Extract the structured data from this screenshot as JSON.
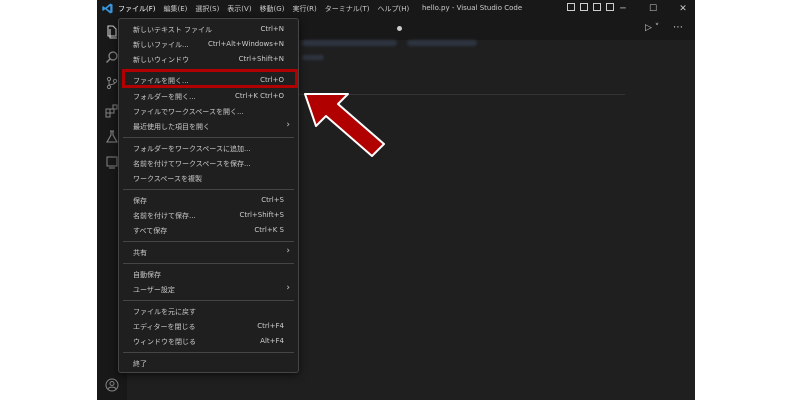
{
  "window_title": "hello.py - Visual Studio Code",
  "menubar": [
    "ファイル(F)",
    "編集(E)",
    "選択(S)",
    "表示(V)",
    "移動(G)",
    "実行(R)",
    "ターミナル(T)",
    "ヘルプ(H)"
  ],
  "window_controls": {
    "minimize": "─",
    "maximize": "☐",
    "close": "✕"
  },
  "activity_icons": [
    "explorer-icon",
    "search-icon",
    "source-control-icon",
    "extensions-icon",
    "testing-icon",
    "remote-icon",
    "account-icon"
  ],
  "file_menu": {
    "items": [
      {
        "label": "新しいテキスト ファイル",
        "shortcut": "Ctrl+N"
      },
      {
        "label": "新しいファイル...",
        "shortcut": "Ctrl+Alt+Windows+N"
      },
      {
        "label": "新しいウィンドウ",
        "shortcut": "Ctrl+Shift+N"
      },
      {
        "label": "ファイルを開く...",
        "shortcut": "Ctrl+O"
      },
      {
        "label": "フォルダーを開く...",
        "shortcut": "Ctrl+K Ctrl+O"
      },
      {
        "label": "ファイルでワークスペースを開く...",
        "shortcut": ""
      },
      {
        "label": "最近使用した項目を開く",
        "shortcut": "",
        "submenu": true
      },
      {
        "label": "フォルダーをワークスペースに追加...",
        "shortcut": ""
      },
      {
        "label": "名前を付けてワークスペースを保存...",
        "shortcut": ""
      },
      {
        "label": "ワークスペースを複製",
        "shortcut": ""
      },
      {
        "label": "保存",
        "shortcut": "Ctrl+S"
      },
      {
        "label": "名前を付けて保存...",
        "shortcut": "Ctrl+Shift+S"
      },
      {
        "label": "すべて保存",
        "shortcut": "Ctrl+K S"
      },
      {
        "label": "共有",
        "shortcut": "",
        "submenu": true
      },
      {
        "label": "自動保存",
        "shortcut": ""
      },
      {
        "label": "ユーザー設定",
        "shortcut": "",
        "submenu": true
      },
      {
        "label": "ファイルを元に戻す",
        "shortcut": ""
      },
      {
        "label": "エディターを閉じる",
        "shortcut": "Ctrl+F4"
      },
      {
        "label": "ウィンドウを閉じる",
        "shortcut": "Alt+F4"
      },
      {
        "label": "終了",
        "shortcut": ""
      }
    ]
  },
  "colors": {
    "highlight": "#b00000",
    "background": "#1f1f1f",
    "menu_text": "#cccccc"
  }
}
